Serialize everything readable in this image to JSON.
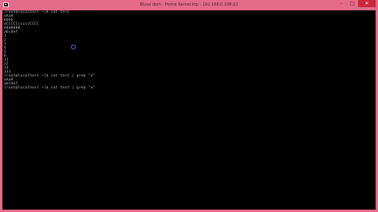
{
  "window": {
    "title": "Blusa dom - Home Server.krp - 192.168.0.108:22",
    "controls": {
      "minimize": "–",
      "maximize": "□",
      "close": "✕"
    }
  },
  "terminal": {
    "lines": [
      "[root@localhost ~]$ cat test",
      "aAaA",
      "bbbb",
      "aCCCCCcccccCCCC",
      "ddd0000",
      "abcdef",
      "1",
      "2",
      "3",
      "4",
      "5",
      "6",
      "11",
      "22",
      "33",
      "111",
      "[root@localhost ~]$ cat test | grep \"a\"",
      "aAaA",
      "abcdef",
      "[root@localhost ~]$ cat test | grep \"a\""
    ]
  },
  "icons": {
    "app": "terminal-app-icon",
    "busy_cursor": "loading-spinner-icon"
  },
  "colors": {
    "accent": "#e46b8a",
    "terminal_bg": "#000000",
    "terminal_text": "#c8c8c8",
    "close_button": "#c8283a",
    "spinner": "#3a7fd5"
  }
}
